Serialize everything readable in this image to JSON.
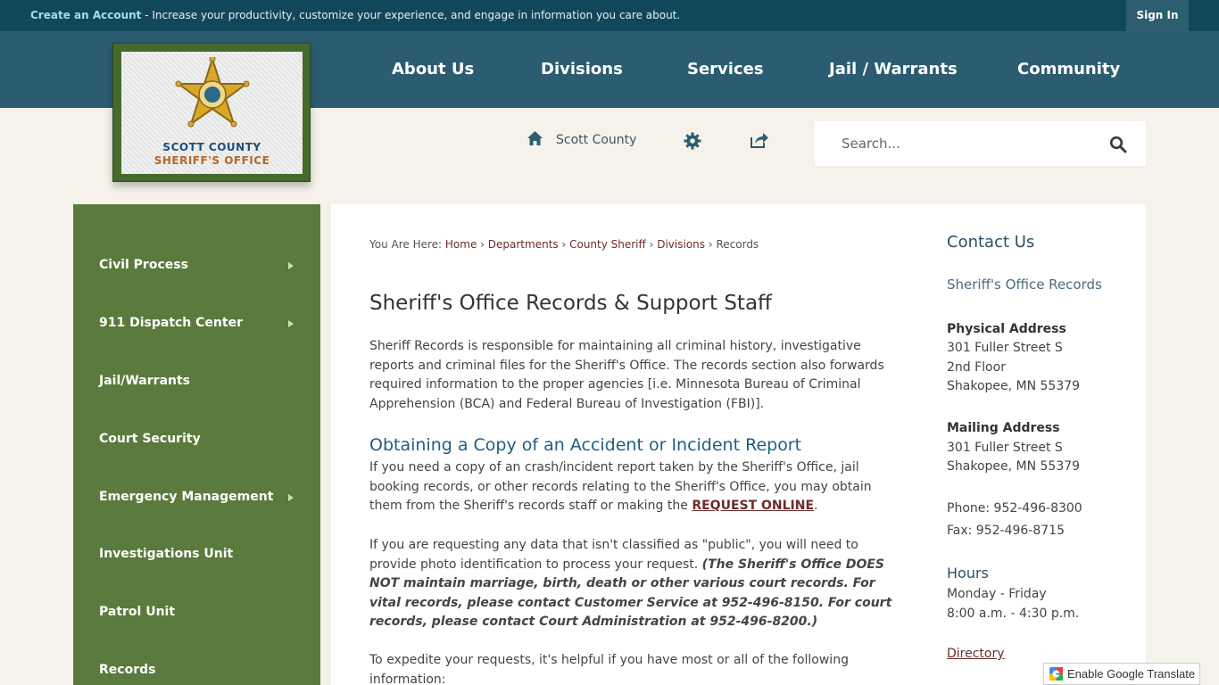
{
  "topbar": {
    "create_account": "Create an Account",
    "promo_text": " - Increase your productivity, customize your experience, and engage in information you care about.",
    "sign_in": "Sign In"
  },
  "nav": {
    "items": [
      "About Us",
      "Divisions",
      "Services",
      "Jail / Warrants",
      "Community"
    ]
  },
  "logo": {
    "line1": "SCOTT COUNTY",
    "line2": "SHERIFF'S OFFICE"
  },
  "utility": {
    "home_label": "Scott County",
    "search_placeholder": "Search..."
  },
  "sidebar": {
    "items": [
      {
        "label": "Civil Process",
        "has_submenu": true
      },
      {
        "label": "911 Dispatch Center",
        "has_submenu": true
      },
      {
        "label": "Jail/Warrants",
        "has_submenu": false
      },
      {
        "label": "Court Security",
        "has_submenu": false
      },
      {
        "label": "Emergency Management",
        "has_submenu": true
      },
      {
        "label": "Investigations Unit",
        "has_submenu": false
      },
      {
        "label": "Patrol Unit",
        "has_submenu": false
      },
      {
        "label": "Records",
        "has_submenu": false
      }
    ]
  },
  "breadcrumb": {
    "prefix": "You Are Here:",
    "links": [
      "Home",
      "Departments",
      "County Sheriff",
      "Divisions"
    ],
    "current": "Records"
  },
  "main": {
    "title": "Sheriff's Office Records & Support Staff",
    "intro": "Sheriff Records is responsible for maintaining all criminal history, investigative reports and criminal files for the Sheriff's Office. The records section also forwards required information to the proper agencies [i.e. Minnesota Bureau of Criminal Apprehension (BCA) and Federal Bureau of Investigation (FBI)].",
    "heading2": "Obtaining a Copy of an Accident or Incident Report",
    "para2_text": "If you need a copy of an crash/incident report taken by the Sheriff's Office, jail booking records, or other records relating to the Sheriff's Office, you may obtain them from the Sheriff's records staff or making the ",
    "para2_link": "REQUEST ONLINE",
    "para2_end": ".",
    "para3_text": "If you are requesting any data that isn't classified as \"public\", you will need to provide photo identification to process your request.  ",
    "para3_bold": "(The Sheriff's Office DOES NOT maintain marriage, birth, death or other various court records.  For vital records, please contact Customer Service at 952-496-8150.  For court records, please contact Court Administration at 952-496-8200.)",
    "para4": "To expedite your requests, it's helpful if you have most or all of the following information:"
  },
  "contact": {
    "title": "Contact Us",
    "dept": "Sheriff's Office Records",
    "physical_label": "Physical Address",
    "physical_lines": [
      "301 Fuller Street S",
      "2nd Floor",
      "Shakopee, MN 55379"
    ],
    "mailing_label": "Mailing Address",
    "mailing_lines": [
      "301 Fuller Street S",
      "Shakopee, MN 55379"
    ],
    "phone": "Phone: 952-496-8300",
    "fax": "Fax: 952-496-8715",
    "hours_title": "Hours",
    "hours_lines": [
      "Monday - Friday",
      "8:00 a.m. - 4:30 p.m."
    ],
    "directory": "Directory"
  },
  "translate": {
    "label": "Enable Google Translate"
  },
  "colors": {
    "topbar": "#11475a",
    "nav": "#2b5c71",
    "sidebar": "#5b7a3d",
    "link": "#6d2b2b",
    "heading": "#1f5e80"
  }
}
